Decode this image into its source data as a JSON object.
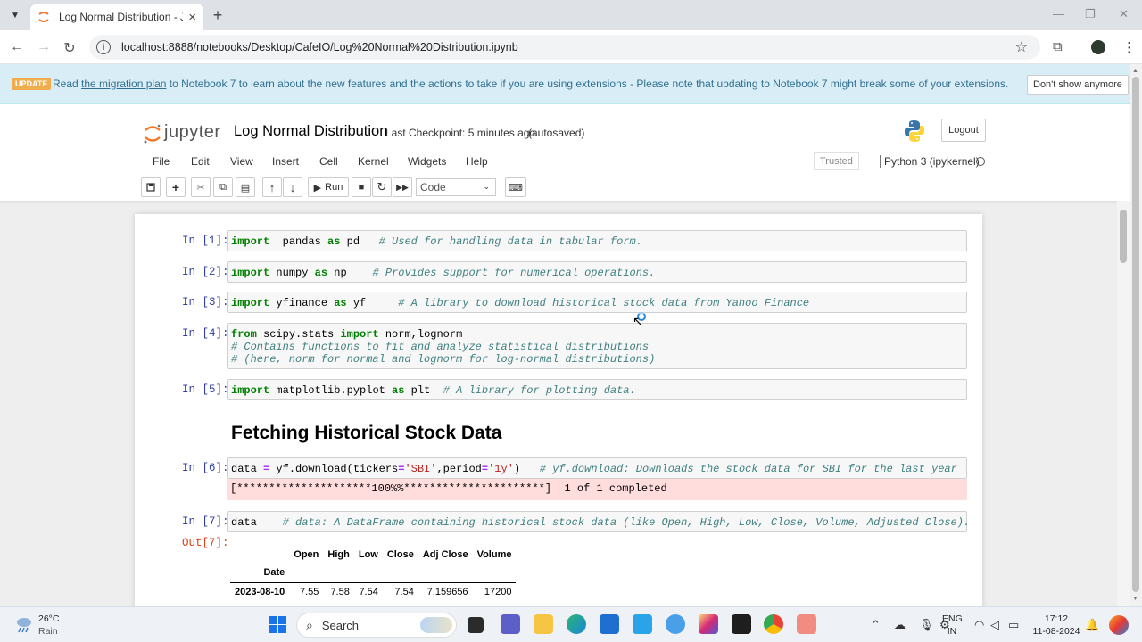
{
  "browser": {
    "tab_title": "Log Normal Distribution - Jupyter",
    "url": "localhost:8888/notebooks/Desktop/CafeIO/Log%20Normal%20Distribution.ipynb",
    "new_tab": "+",
    "tab_close": "×"
  },
  "banner": {
    "badge": "UPDATE",
    "text_before": "Read ",
    "link": "the migration plan",
    "text_after": " to Notebook 7 to learn about the new features and the actions to take if you are using extensions - Please note that updating to Notebook 7 might break some of your extensions.",
    "dismiss": "Don't show anymore"
  },
  "header": {
    "logo_text": "jupyter",
    "notebook_name": "Log Normal Distribution",
    "checkpoint": "Last Checkpoint: 5 minutes ago",
    "autosaved": "(autosaved)",
    "logout": "Logout"
  },
  "menu": [
    "File",
    "Edit",
    "View",
    "Insert",
    "Cell",
    "Kernel",
    "Widgets",
    "Help"
  ],
  "kernel": {
    "trusted": "Trusted",
    "name": "Python 3 (ipykernel)"
  },
  "toolbar": {
    "run_label": "Run",
    "cell_type": "Code"
  },
  "cells": [
    {
      "prompt": "In [1]:",
      "code": [
        [
          [
            "kw",
            "import"
          ],
          [
            "",
            "  pandas "
          ],
          [
            "kw",
            "as"
          ],
          [
            "",
            " pd   "
          ],
          [
            "cm",
            "# Used for handling data in tabular form."
          ]
        ]
      ]
    },
    {
      "prompt": "In [2]:",
      "code": [
        [
          [
            "kw",
            "import"
          ],
          [
            "",
            " numpy "
          ],
          [
            "kw",
            "as"
          ],
          [
            "",
            " np    "
          ],
          [
            "cm",
            "# Provides support for numerical operations."
          ]
        ]
      ]
    },
    {
      "prompt": "In [3]:",
      "code": [
        [
          [
            "kw",
            "import"
          ],
          [
            "",
            " yfinance "
          ],
          [
            "kw",
            "as"
          ],
          [
            "",
            " yf     "
          ],
          [
            "cm",
            "# A library to download historical stock data from Yahoo Finance"
          ]
        ]
      ]
    },
    {
      "prompt": "In [4]:",
      "code": [
        [
          [
            "kw",
            "from"
          ],
          [
            "",
            " scipy.stats "
          ],
          [
            "kw",
            "import"
          ],
          [
            "",
            " norm,lognorm"
          ]
        ],
        [
          [
            "cm",
            "# Contains functions to fit and analyze statistical distributions"
          ]
        ],
        [
          [
            "cm",
            "# (here, norm for normal and lognorm for log-normal distributions)"
          ]
        ]
      ]
    },
    {
      "prompt": "In [5]:",
      "code": [
        [
          [
            "kw",
            "import"
          ],
          [
            "",
            " matplotlib.pyplot "
          ],
          [
            "kw",
            "as"
          ],
          [
            "",
            " plt  "
          ],
          [
            "cm",
            "# A library for plotting data."
          ]
        ]
      ]
    },
    {
      "heading": "Fetching Historical Stock Data"
    },
    {
      "prompt": "In [6]:",
      "code": [
        [
          [
            "",
            "data "
          ],
          [
            "op",
            "="
          ],
          [
            "",
            " yf.download(tickers"
          ],
          [
            "op",
            "="
          ],
          [
            "st",
            "'SBI'"
          ],
          [
            "",
            ",period"
          ],
          [
            "op",
            "="
          ],
          [
            "st",
            "'1y'"
          ],
          [
            "",
            ")   "
          ],
          [
            "cm",
            "# yf.download: Downloads the stock data for SBI for the last year"
          ]
        ]
      ],
      "stderr": "[*********************100%%**********************]  1 of 1 completed"
    },
    {
      "prompt": "In [7]:",
      "code": [
        [
          [
            "",
            "data    "
          ],
          [
            "cm",
            "# data: A DataFrame containing historical stock data (like Open, High, Low, Close, Volume, Adjusted Close)."
          ]
        ]
      ]
    }
  ],
  "output7": {
    "prompt": "Out[7]:",
    "columns": [
      "Open",
      "High",
      "Low",
      "Close",
      "Adj Close",
      "Volume"
    ],
    "index_name": "Date",
    "rows": [
      {
        "index": "2023-08-10",
        "values": [
          "7.55",
          "7.58",
          "7.54",
          "7.54",
          "7.159656",
          "17200"
        ]
      }
    ]
  },
  "taskbar": {
    "temperature": "26°C",
    "condition": "Rain",
    "search": "Search",
    "lang1": "ENG",
    "lang2": "IN",
    "time": "17:12",
    "date": "11-08-2024"
  }
}
